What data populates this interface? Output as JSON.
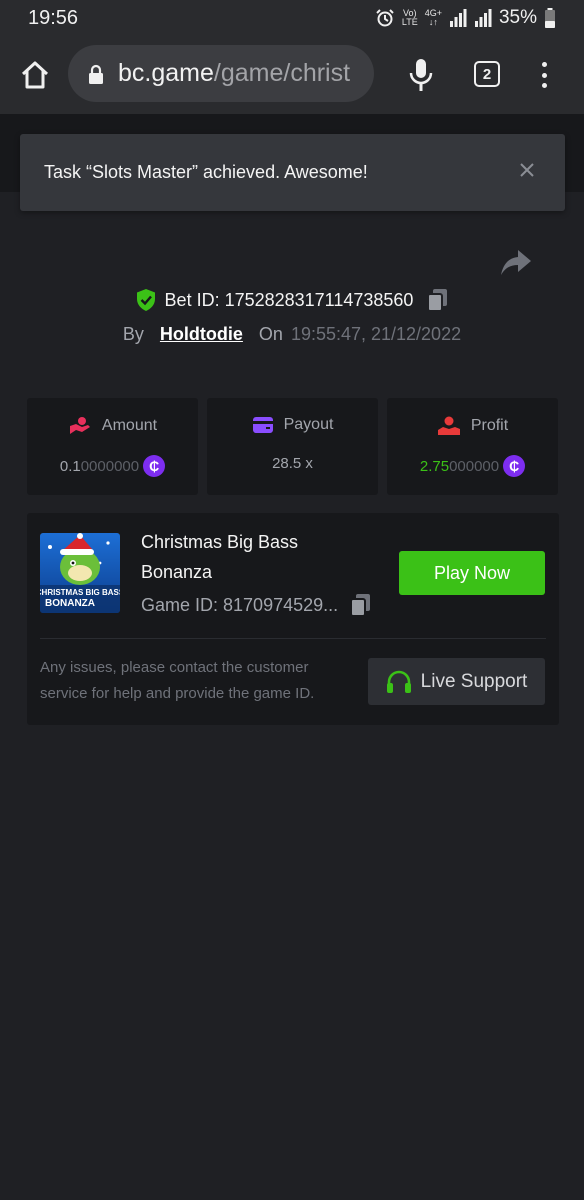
{
  "status_bar": {
    "time": "19:56",
    "volte_top": "Vo)",
    "volte_bottom": "LTE",
    "net_top": "4G+",
    "battery_percent": "35%"
  },
  "browser": {
    "url_domain": "bc.game",
    "url_path": "/game/christ",
    "tab_count": "2"
  },
  "toast": {
    "message": "Task “Slots Master” achieved. Awesome!"
  },
  "bet": {
    "id_text": "Bet ID: 1752828317114738560",
    "by_label": "By",
    "user": "Holdtodie",
    "on_label": "On",
    "datetime": "19:55:47, 21/12/2022"
  },
  "stats": {
    "amount_label": "Amount",
    "amount_main": "0.1",
    "amount_dim": "0000000",
    "payout_label": "Payout",
    "payout_value": "28.5 x",
    "profit_label": "Profit",
    "profit_main": "2.75",
    "profit_dim": "000000",
    "coin_symbol": "₵"
  },
  "game": {
    "title": "Christmas Big Bass Bonanza",
    "thumb_line1": "CHRISTMAS BIG BASS",
    "thumb_line2": "BONANZA",
    "game_id": "Game ID: 8170974529...",
    "play_label": "Play Now",
    "support_text": "Any issues, please contact the customer service for help and provide the game ID.",
    "support_label": "Live Support"
  },
  "colors": {
    "accent_green": "#3bc117",
    "coin_purple": "#7d2df0",
    "amount_icon": "#e8305c",
    "payout_icon": "#8a4dff",
    "profit_icon": "#e83a3a",
    "background": "#1f2024",
    "card": "#17181b"
  }
}
